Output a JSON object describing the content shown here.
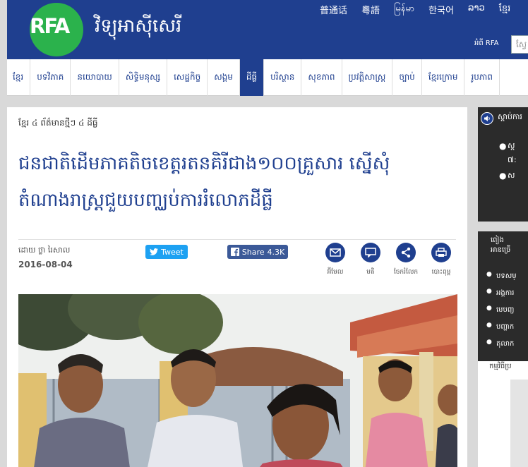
{
  "header": {
    "logo_text": "RFA",
    "site_title": "វិទ្យុអាស៊ីសេរី",
    "languages": [
      "普通话",
      "粵語",
      "မြန်မာ",
      "한국어",
      "ລາວ",
      "ខ្មែរ"
    ],
    "about_label": "អំពី RFA",
    "search_placeholder": "ស្វែ"
  },
  "nav": {
    "items": [
      "ខ្មែរ",
      "បទវិភាគ",
      "នយោបាយ",
      "សិទ្ធិមនុស្ស",
      "សេដ្ឋកិច្ច",
      "សង្គម",
      "ដីធ្លី",
      "បរិស្ថាន",
      "សុខភាព",
      "ប្រវត្តិសាស្ត្រ",
      "ច្បាប់",
      "ខ្មែរក្រោម",
      "រូបភាព"
    ],
    "active_index": 6
  },
  "article": {
    "breadcrumb": "ខ្មែរ ៤ ព័ត៌មានថ្មីៗ ៤ ដីធ្លី",
    "headline": "ជនជាតិដើមភាគតិចខេត្តរតនគិរីជាង១០០គ្រួសារ ស្នើសុំតំណាងរាស្ត្រជួយបញ្ឈប់ការរំលោភដីធ្លី",
    "byline": "ដោយ ថ្លា រៃសាល",
    "date": "2016-08-04",
    "tweet_label": "Tweet",
    "share_label": "Share",
    "share_count": "4.3K",
    "tools": [
      {
        "icon": "email-icon",
        "label": "អ៊ីមែល"
      },
      {
        "icon": "comment-icon",
        "label": "មតិ"
      },
      {
        "icon": "share-icon",
        "label": "ចែករំលែក"
      },
      {
        "icon": "print-icon",
        "label": "បោះពុម្ព"
      }
    ]
  },
  "sidebar": {
    "listen_label": "ស្ដាប់ការ",
    "box1_items": [
      "ស្ដ",
      "៧:",
      "ស"
    ],
    "box2_heading_1": "ពៀង",
    "box2_heading_2": "អានច្រើ",
    "box2_items": [
      "បទសម្",
      "អង្គការ",
      "មេបញ្ជ",
      "បញ្ហាក",
      "តុលាក"
    ],
    "more_text": "កម្មវិធីប្រ"
  },
  "colors": {
    "brand_blue": "#1f3f8f",
    "logo_green": "#2bb24c",
    "twitter": "#1da1f2",
    "facebook": "#3b5998",
    "sidebar_dark": "#2b2b2b"
  }
}
